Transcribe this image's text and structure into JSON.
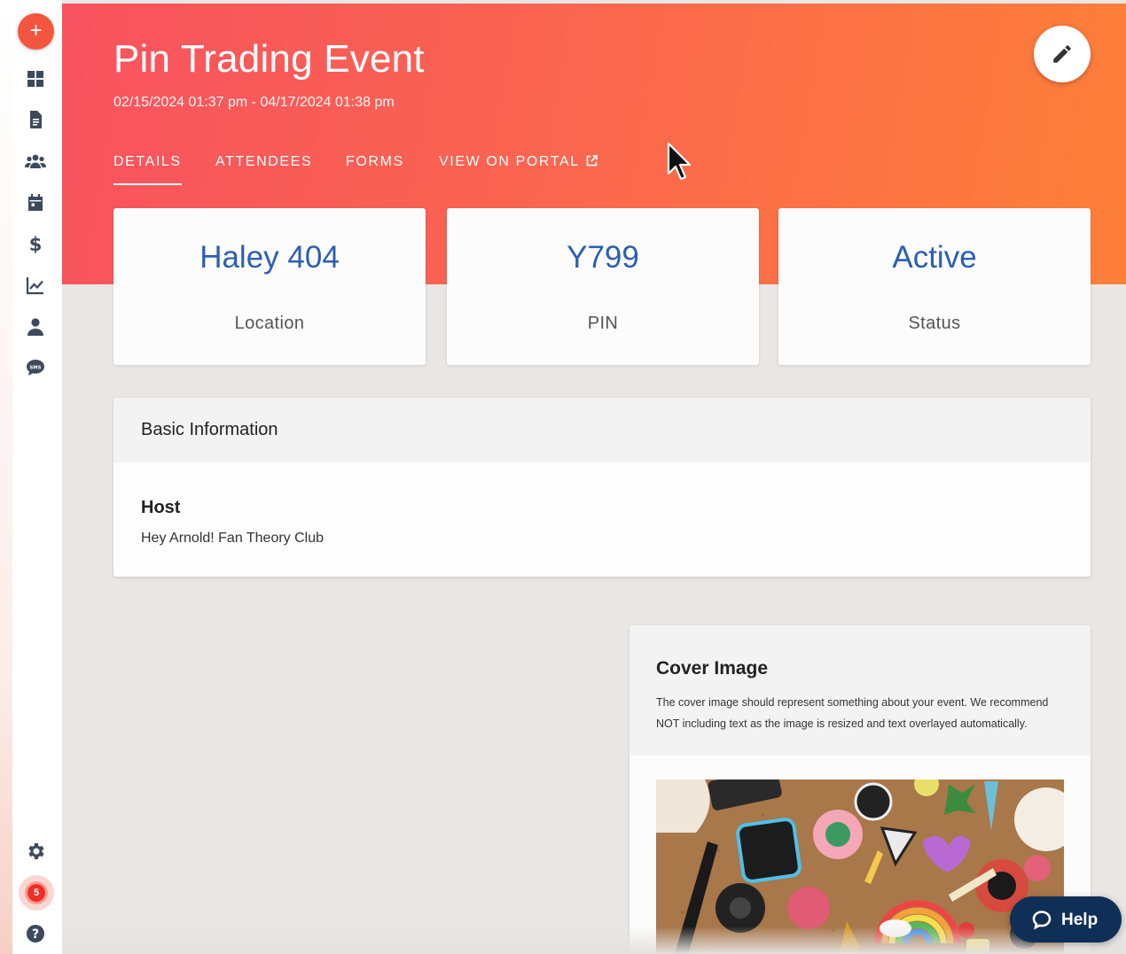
{
  "header": {
    "title": "Pin Trading Event",
    "dates": "02/15/2024 01:37 pm - 04/17/2024 01:38 pm"
  },
  "tabs": [
    {
      "label": "DETAILS",
      "active": true
    },
    {
      "label": "ATTENDEES",
      "active": false
    },
    {
      "label": "FORMS",
      "active": false
    },
    {
      "label": "VIEW ON PORTAL",
      "active": false,
      "icon": "external-link-icon"
    }
  ],
  "stats": [
    {
      "value": "Haley 404",
      "label": "Location"
    },
    {
      "value": "Y799",
      "label": "PIN"
    },
    {
      "value": "Active",
      "label": "Status"
    }
  ],
  "basic_info": {
    "heading": "Basic Information",
    "host_label": "Host",
    "host_value": "Hey Arnold! Fan Theory Club"
  },
  "cover": {
    "title": "Cover Image",
    "description": "The cover image should represent something about your event. We recommend NOT including text as the image is resized and text overlayed automatically."
  },
  "sidebar": {
    "add_icon": "plus-icon",
    "items": [
      "dashboard-icon",
      "document-icon",
      "users-icon",
      "calendar-icon",
      "dollar-icon",
      "chart-icon",
      "person-icon",
      "sms-icon"
    ],
    "bottom": [
      "gear-icon",
      "notification-badge",
      "help-circle-icon"
    ],
    "notification_count": "5"
  },
  "help": {
    "label": "Help"
  },
  "colors": {
    "accent": "#f4553f",
    "hero_start": "#f7525f",
    "hero_end": "#fe8038",
    "stat_value": "#2b5fb4",
    "help_bg": "#0f2f56"
  }
}
